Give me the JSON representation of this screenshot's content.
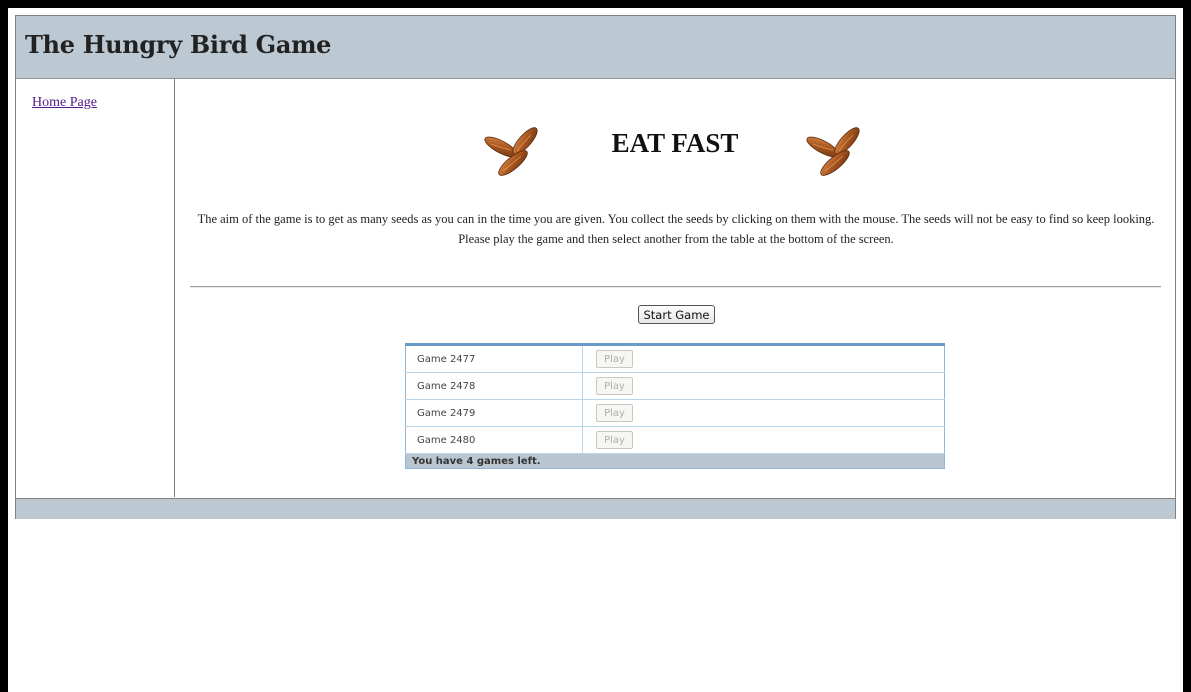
{
  "header": {
    "title": "The Hungry Bird Game"
  },
  "sidebar": {
    "home_link": "Home Page"
  },
  "main": {
    "game_title": "EAT FAST",
    "instructions": "The aim of the game is to get as many seeds as you can in the time you are given. You collect the seeds by clicking on them with the mouse. The seeds will not be easy to find so keep looking. Please play the game and then select another from the table at the bottom of the screen.",
    "start_button": "Start Game",
    "games": [
      {
        "name": "Game 2477",
        "action": "Play"
      },
      {
        "name": "Game 2478",
        "action": "Play"
      },
      {
        "name": "Game 2479",
        "action": "Play"
      },
      {
        "name": "Game 2480",
        "action": "Play"
      }
    ],
    "games_left": "You have 4 games left."
  },
  "icons": {
    "seed_decoration": "seeds-icon"
  },
  "colors": {
    "header_bg": "#bcc8d2",
    "link": "#551a8b",
    "table_border": "#6a9bc8",
    "seed_brown": "#a0521d"
  }
}
